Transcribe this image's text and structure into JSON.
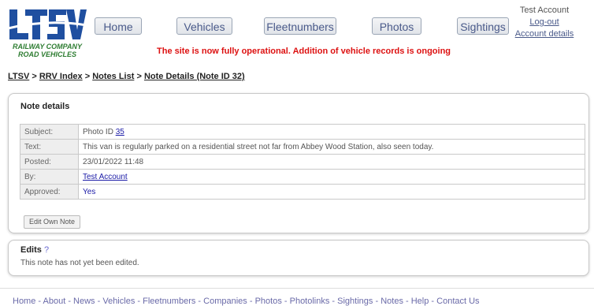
{
  "logo": {
    "text": "LTSV",
    "subtitle_line1": "RAILWAY COMPANY",
    "subtitle_line2": "ROAD VEHICLES"
  },
  "nav": [
    "Home",
    "Vehicles",
    "Fleetnumbers",
    "Photos",
    "Sightings"
  ],
  "account": {
    "name": "Test Account",
    "logout": "Log-out",
    "details": "Account details"
  },
  "banner": "The site is now fully operational. Addition of vehicle records is ongoing",
  "breadcrumb": {
    "items": [
      "LTSV",
      "RRV Index",
      "Notes List",
      "Note Details (Note ID 32)"
    ],
    "separator": " > "
  },
  "note": {
    "title": "Note details",
    "rows": [
      {
        "label": "Subject:",
        "text": "Photo ID ",
        "link": "35"
      },
      {
        "label": "Text:",
        "text": "This van is regularly parked on a residential street not far from Abbey Wood Station, also seen today."
      },
      {
        "label": "Posted:",
        "text": "23/01/2022 11:48"
      },
      {
        "label": "By:",
        "link": "Test Account"
      },
      {
        "label": "Approved:",
        "link": "Yes"
      }
    ],
    "edit_button": "Edit Own Note"
  },
  "edits": {
    "title": "Edits",
    "help": "?",
    "text": "This note has not yet been edited."
  },
  "footer": {
    "links": [
      "Home",
      "About",
      "News",
      "Vehicles",
      "Fleetnumbers",
      "Companies",
      "Photos",
      "Photolinks",
      "Sightings",
      "Notes",
      "Help",
      "Contact Us"
    ],
    "separator": " - "
  },
  "colors": {
    "banner": "#dd1111",
    "logo_blue": "#1f4fa0",
    "logo_green": "#2e7d32",
    "link": "#1a1aa6"
  }
}
